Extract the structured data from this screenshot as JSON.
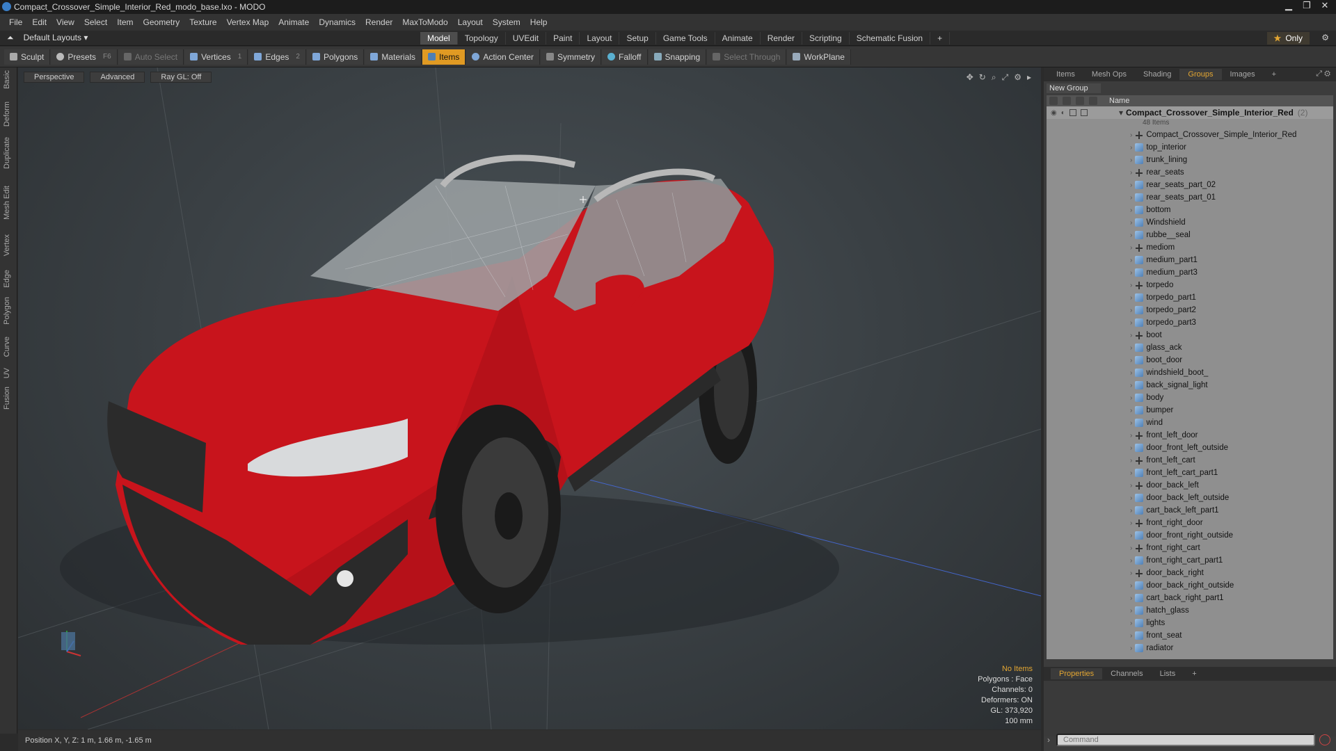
{
  "window": {
    "title": "Compact_Crossover_Simple_Interior_Red_modo_base.lxo - MODO"
  },
  "menu": [
    "File",
    "Edit",
    "View",
    "Select",
    "Item",
    "Geometry",
    "Texture",
    "Vertex Map",
    "Animate",
    "Dynamics",
    "Render",
    "MaxToModo",
    "Layout",
    "System",
    "Help"
  ],
  "layout": {
    "selector": "Default Layouts ▾"
  },
  "mode_tabs": [
    {
      "label": "Model",
      "active": true
    },
    {
      "label": "Topology"
    },
    {
      "label": "UVEdit"
    },
    {
      "label": "Paint"
    },
    {
      "label": "Layout"
    },
    {
      "label": "Setup"
    },
    {
      "label": "Game Tools"
    },
    {
      "label": "Animate"
    },
    {
      "label": "Render"
    },
    {
      "label": "Scripting"
    },
    {
      "label": "Schematic Fusion"
    }
  ],
  "only_label": "Only",
  "toolbar": {
    "sculpt": "Sculpt",
    "presets": "Presets",
    "presets_key": "F6",
    "auto_select": "Auto Select",
    "vertices": "Vertices",
    "vertices_count": "1",
    "edges": "Edges",
    "edges_count": "2",
    "polygons": "Polygons",
    "materials": "Materials",
    "items": "Items",
    "action_center": "Action Center",
    "symmetry": "Symmetry",
    "falloff": "Falloff",
    "snapping": "Snapping",
    "select_through": "Select Through",
    "workplane": "WorkPlane"
  },
  "left_tabs": [
    "Basic",
    "Deform",
    "Duplicate",
    "Mesh Edit",
    "Vertex",
    "Edge",
    "Polygon",
    "Curve",
    "UV",
    "Fusion"
  ],
  "viewport": {
    "view": "Perspective",
    "shading": "Advanced",
    "raygl": "Ray GL: Off",
    "info": {
      "no_items": "No Items",
      "polygons": "Polygons : Face",
      "channels": "Channels: 0",
      "deformers": "Deformers: ON",
      "gl": "GL: 373,920",
      "scale": "100 mm"
    }
  },
  "status": {
    "position": "Position X, Y, Z:  1 m, 1.66 m, -1.65 m"
  },
  "right_tabs": [
    "Items",
    "Mesh Ops",
    "Shading",
    "Groups",
    "Images"
  ],
  "groups": {
    "new_group": "New Group",
    "name_header": "Name",
    "group_name": "Compact_Crossover_Simple_Interior_Red",
    "group_count": "(2)",
    "items_count": "48 Items",
    "items": [
      {
        "name": "Compact_Crossover_Simple_Interior_Red",
        "type": "loc"
      },
      {
        "name": "top_interior",
        "type": "mesh"
      },
      {
        "name": "trunk_lining",
        "type": "mesh"
      },
      {
        "name": "rear_seats",
        "type": "loc"
      },
      {
        "name": "rear_seats_part_02",
        "type": "mesh"
      },
      {
        "name": "rear_seats_part_01",
        "type": "mesh"
      },
      {
        "name": "bottom",
        "type": "mesh"
      },
      {
        "name": "Windshield",
        "type": "mesh"
      },
      {
        "name": "rubbe__seal",
        "type": "mesh"
      },
      {
        "name": "mediom",
        "type": "loc"
      },
      {
        "name": "medium_part1",
        "type": "mesh"
      },
      {
        "name": "medium_part3",
        "type": "mesh"
      },
      {
        "name": "torpedo",
        "type": "loc"
      },
      {
        "name": "torpedo_part1",
        "type": "mesh"
      },
      {
        "name": "torpedo_part2",
        "type": "mesh"
      },
      {
        "name": "torpedo_part3",
        "type": "mesh"
      },
      {
        "name": "boot",
        "type": "loc"
      },
      {
        "name": "glass_ack",
        "type": "mesh"
      },
      {
        "name": "boot_door",
        "type": "mesh"
      },
      {
        "name": "windshield_boot_",
        "type": "mesh"
      },
      {
        "name": "back_signal_light",
        "type": "mesh"
      },
      {
        "name": "body",
        "type": "mesh"
      },
      {
        "name": "bumper",
        "type": "mesh"
      },
      {
        "name": "wind",
        "type": "mesh"
      },
      {
        "name": "front_left_door",
        "type": "loc"
      },
      {
        "name": "door_front_left_outside",
        "type": "mesh"
      },
      {
        "name": "front_left_cart",
        "type": "loc"
      },
      {
        "name": "front_left_cart_part1",
        "type": "mesh"
      },
      {
        "name": "door_back_left",
        "type": "loc"
      },
      {
        "name": "door_back_left_outside",
        "type": "mesh"
      },
      {
        "name": "cart_back_left_part1",
        "type": "mesh"
      },
      {
        "name": "front_right_door",
        "type": "loc"
      },
      {
        "name": "door_front_right_outside",
        "type": "mesh"
      },
      {
        "name": "front_right_cart",
        "type": "loc"
      },
      {
        "name": "front_right_cart_part1",
        "type": "mesh"
      },
      {
        "name": "door_back_right",
        "type": "loc"
      },
      {
        "name": "door_back_right_outside",
        "type": "mesh"
      },
      {
        "name": "cart_back_right_part1",
        "type": "mesh"
      },
      {
        "name": "hatch_glass",
        "type": "mesh"
      },
      {
        "name": "lights",
        "type": "mesh"
      },
      {
        "name": "front_seat",
        "type": "mesh"
      },
      {
        "name": "radiator",
        "type": "mesh"
      }
    ]
  },
  "props_tabs": [
    "Properties",
    "Channels",
    "Lists"
  ],
  "command": {
    "placeholder": "Command"
  },
  "colors": {
    "accent": "#e3a632",
    "car_body": "#c8141c"
  }
}
